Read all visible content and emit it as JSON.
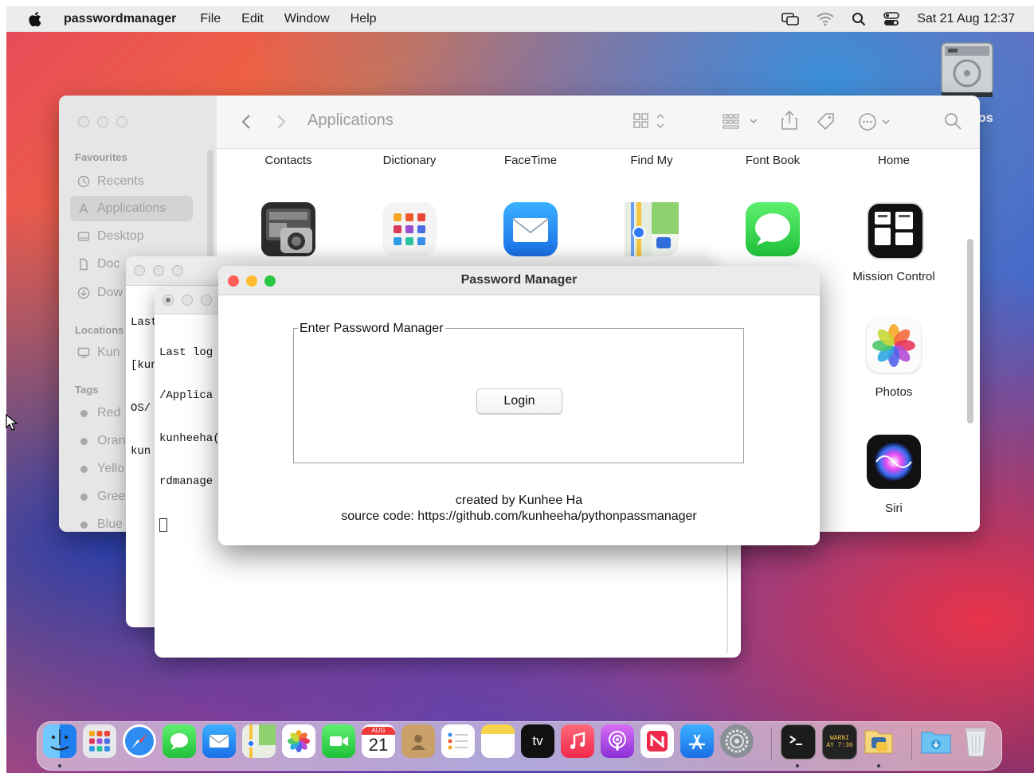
{
  "menubar": {
    "app_name": "passwordmanager",
    "menus": [
      "File",
      "Edit",
      "Window",
      "Help"
    ],
    "clock": "Sat 21 Aug  12:37"
  },
  "desktop": {
    "drive_label_visible": "os"
  },
  "finder": {
    "title": "Applications",
    "sidebar": {
      "favourites_header": "Favourites",
      "favourites": [
        "Recents",
        "Applications",
        "Desktop",
        "Doc",
        "Dow"
      ],
      "locations_header": "Locations",
      "locations": [
        "Kun"
      ],
      "tags_header": "Tags",
      "tags": [
        {
          "label": "Red",
          "color": "#a8a8a8"
        },
        {
          "label": "Oran",
          "color": "#a8a8a8"
        },
        {
          "label": "Yello",
          "color": "#a8a8a8"
        },
        {
          "label": "Gree",
          "color": "#a8a8a8"
        },
        {
          "label": "Blue",
          "color": "#a8a8a8"
        }
      ]
    },
    "apps_row1": [
      "Contacts",
      "Dictionary",
      "FaceTime",
      "Find My",
      "Font Book",
      "Home"
    ],
    "apps_right": [
      "Mission Control",
      "Photos",
      "Siri"
    ]
  },
  "terminal_back": {
    "lines": [
      "Last",
      "[kun",
      "OS/",
      "kun"
    ]
  },
  "terminal_front": {
    "lines": [
      "Last log",
      "/Applica",
      "kunheeha(",
      "rdmanage"
    ]
  },
  "password_manager": {
    "window_title": "Password Manager",
    "frame_label": "Enter Password Manager",
    "login_button": "Login",
    "credit_line": "created by Kunhee Ha",
    "source_line": "source code: https://github.com/kunheeha/pythonpassmanager"
  },
  "dock": {
    "calendar_month": "AUG",
    "calendar_day": "21",
    "tv_label": "tv",
    "console_label": "WARNI",
    "console_time": "AY 7:36"
  },
  "colors": {
    "close": "#fe5f57",
    "minimize": "#febc2e",
    "zoom": "#28c840"
  }
}
